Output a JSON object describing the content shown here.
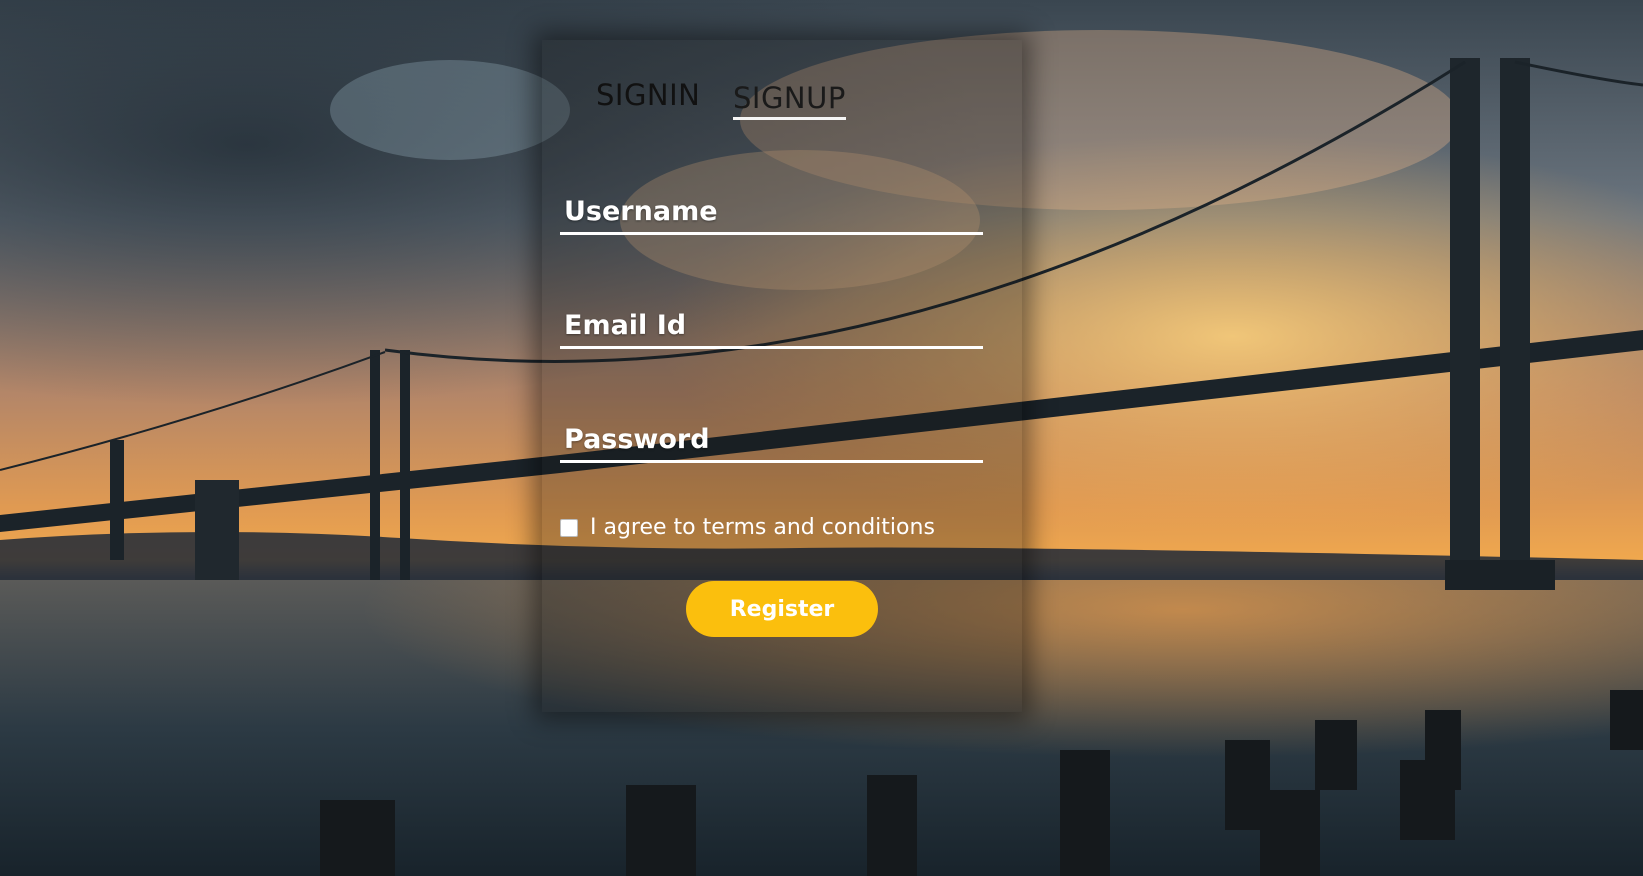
{
  "tabs": {
    "signin_label": "SIGNIN",
    "signup_label": "SIGNUP",
    "active": "SIGNUP"
  },
  "form": {
    "username_placeholder": "Username",
    "email_placeholder": "Email Id",
    "password_placeholder": "Password",
    "agree_label": "I agree to terms and conditions",
    "agree_checked": false,
    "register_label": "Register"
  },
  "colors": {
    "accent": "#fbbf0d",
    "text": "#ffffff",
    "tab_text": "#111111"
  }
}
